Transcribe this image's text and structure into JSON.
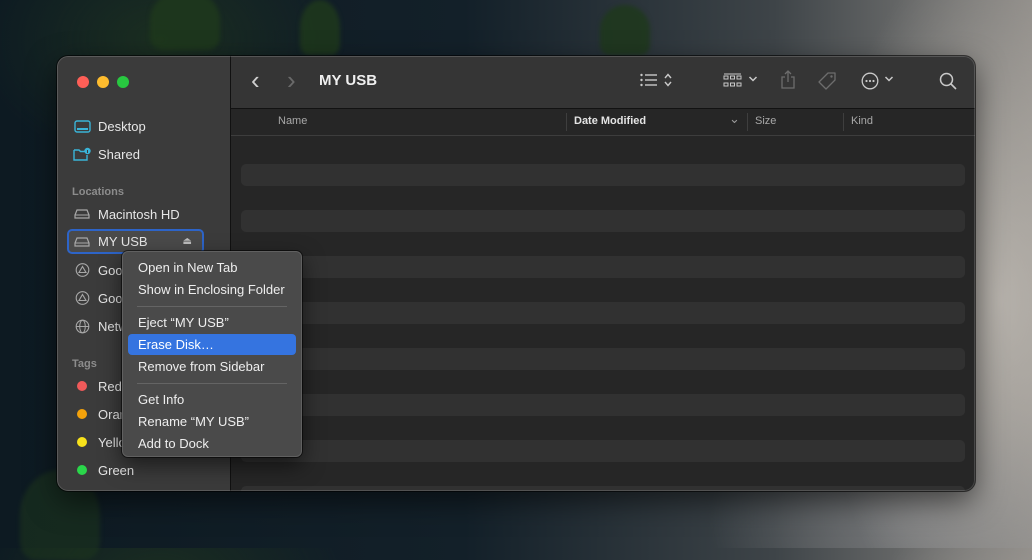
{
  "window": {
    "title": "MY USB",
    "traffic_lights": [
      "close",
      "minimize",
      "zoom"
    ]
  },
  "sidebar": {
    "favorites": [
      {
        "label": "Desktop",
        "icon": "desktop-icon"
      },
      {
        "label": "Shared",
        "icon": "shared-folder-icon"
      }
    ],
    "locations_header": "Locations",
    "locations": [
      {
        "label": "Macintosh HD",
        "icon": "drive-icon"
      },
      {
        "label": "MY USB",
        "icon": "drive-icon",
        "selected": true,
        "eject_icon": "⏏"
      },
      {
        "label": "Goog",
        "icon": "google-drive-icon"
      },
      {
        "label": "Goog",
        "icon": "google-drive-icon"
      },
      {
        "label": "Netw",
        "icon": "network-icon"
      }
    ],
    "tags_header": "Tags",
    "tags": [
      {
        "label": "Red",
        "color": "#f05a5a"
      },
      {
        "label": "Oran",
        "color": "#f4a20b"
      },
      {
        "label": "Yello",
        "color": "#f8e21b"
      },
      {
        "label": "Green",
        "color": "#2ad64a"
      }
    ]
  },
  "toolbar": {
    "back_icon": "‹",
    "forward_icon": "›",
    "icons": [
      "list-view-icon",
      "sort-updown-icon",
      "icon-view-grid-icon",
      "chevron-down-icon",
      "share-icon",
      "tag-icon",
      "more-icon",
      "chevron-down-icon",
      "search-icon"
    ]
  },
  "columns": {
    "name": "Name",
    "date_modified": "Date Modified",
    "size": "Size",
    "kind": "Kind",
    "sort_indicator": "⌄"
  },
  "context_menu": {
    "items": [
      {
        "label": "Open in New Tab"
      },
      {
        "label": "Show in Enclosing Folder"
      },
      {
        "separator": true
      },
      {
        "label": "Eject “MY USB”"
      },
      {
        "label": "Erase Disk…",
        "highlighted": true
      },
      {
        "label": "Remove from Sidebar"
      },
      {
        "separator": true
      },
      {
        "label": "Get Info"
      },
      {
        "label": "Rename “MY USB”"
      },
      {
        "label": "Add to Dock"
      }
    ]
  },
  "colors": {
    "accent": "#3574e0",
    "selection_border": "#2d64c8"
  }
}
